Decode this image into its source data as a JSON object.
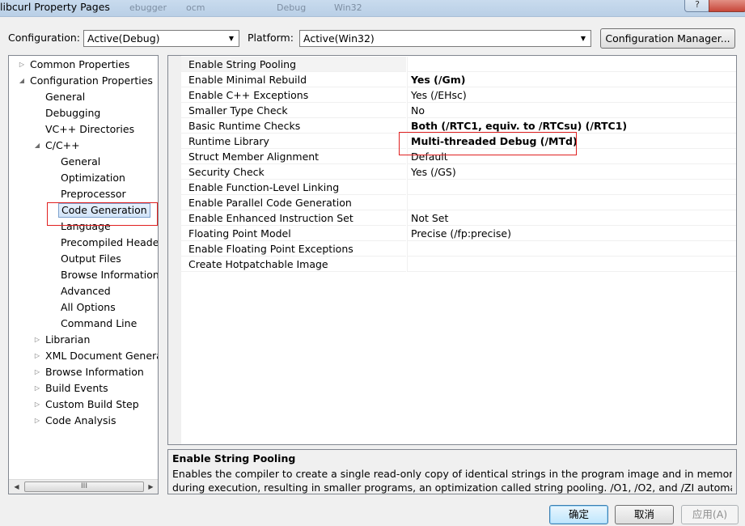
{
  "window": {
    "title": "libcurl Property Pages",
    "background_tabs": [
      "ebugger",
      "ocm",
      "Debug",
      "Win32"
    ]
  },
  "toolbar": {
    "configuration_label": "Configuration:",
    "configuration_value": "Active(Debug)",
    "platform_label": "Platform:",
    "platform_value": "Active(Win32)",
    "config_manager_label": "Configuration Manager..."
  },
  "tree": {
    "items": [
      {
        "label": "Common Properties",
        "level": 0,
        "expander": "collapsed"
      },
      {
        "label": "Configuration Properties",
        "level": 0,
        "expander": "expanded"
      },
      {
        "label": "General",
        "level": 1,
        "expander": "none"
      },
      {
        "label": "Debugging",
        "level": 1,
        "expander": "none"
      },
      {
        "label": "VC++ Directories",
        "level": 1,
        "expander": "none"
      },
      {
        "label": "C/C++",
        "level": 1,
        "expander": "expanded"
      },
      {
        "label": "General",
        "level": 2,
        "expander": "none"
      },
      {
        "label": "Optimization",
        "level": 2,
        "expander": "none"
      },
      {
        "label": "Preprocessor",
        "level": 2,
        "expander": "none"
      },
      {
        "label": "Code Generation",
        "level": 2,
        "expander": "none",
        "selected": true
      },
      {
        "label": "Language",
        "level": 2,
        "expander": "none"
      },
      {
        "label": "Precompiled Header",
        "level": 2,
        "expander": "none"
      },
      {
        "label": "Output Files",
        "level": 2,
        "expander": "none"
      },
      {
        "label": "Browse Information",
        "level": 2,
        "expander": "none"
      },
      {
        "label": "Advanced",
        "level": 2,
        "expander": "none"
      },
      {
        "label": "All Options",
        "level": 2,
        "expander": "none"
      },
      {
        "label": "Command Line",
        "level": 2,
        "expander": "none"
      },
      {
        "label": "Librarian",
        "level": 1,
        "expander": "collapsed"
      },
      {
        "label": "XML Document Generator",
        "level": 1,
        "expander": "collapsed"
      },
      {
        "label": "Browse Information",
        "level": 1,
        "expander": "collapsed"
      },
      {
        "label": "Build Events",
        "level": 1,
        "expander": "collapsed"
      },
      {
        "label": "Custom Build Step",
        "level": 1,
        "expander": "collapsed"
      },
      {
        "label": "Code Analysis",
        "level": 1,
        "expander": "collapsed"
      }
    ],
    "scroll_thumb_glyph": "III"
  },
  "properties": [
    {
      "name": "Enable String Pooling",
      "value": "",
      "bold": false,
      "selected": true
    },
    {
      "name": "Enable Minimal Rebuild",
      "value": "Yes (/Gm)",
      "bold": true
    },
    {
      "name": "Enable C++ Exceptions",
      "value": "Yes (/EHsc)",
      "bold": false
    },
    {
      "name": "Smaller Type Check",
      "value": "No",
      "bold": false
    },
    {
      "name": "Basic Runtime Checks",
      "value": "Both (/RTC1, equiv. to /RTCsu) (/RTC1)",
      "bold": true
    },
    {
      "name": "Runtime Library",
      "value": "Multi-threaded Debug (/MTd)",
      "bold": true,
      "highlighted": true
    },
    {
      "name": "Struct Member Alignment",
      "value": "Default",
      "bold": false
    },
    {
      "name": "Security Check",
      "value": "Yes (/GS)",
      "bold": false
    },
    {
      "name": "Enable Function-Level Linking",
      "value": "",
      "bold": false
    },
    {
      "name": "Enable Parallel Code Generation",
      "value": "",
      "bold": false
    },
    {
      "name": "Enable Enhanced Instruction Set",
      "value": "Not Set",
      "bold": false
    },
    {
      "name": "Floating Point Model",
      "value": "Precise (/fp:precise)",
      "bold": false
    },
    {
      "name": "Enable Floating Point Exceptions",
      "value": "",
      "bold": false
    },
    {
      "name": "Create Hotpatchable Image",
      "value": "",
      "bold": false
    }
  ],
  "description": {
    "title": "Enable String Pooling",
    "line1": "Enables the compiler to create a single read-only copy of identical strings in the program image and in memory",
    "line2": "during execution, resulting in smaller programs, an optimization called string pooling. /O1, /O2, and /ZI  automatical..."
  },
  "footer": {
    "ok_label": "确定",
    "cancel_label": "取消",
    "apply_label": "应用(A)"
  },
  "colors": {
    "highlight_box": "#e02020",
    "selection_border": "#7da2ce",
    "window_bg": "#f0f0f0"
  }
}
